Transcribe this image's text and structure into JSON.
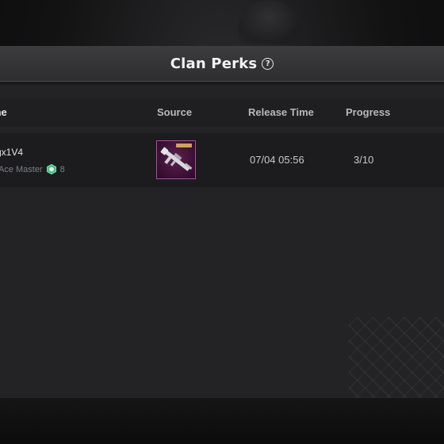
{
  "panel": {
    "title": "Clan Perks",
    "help_icon": "help-circle-icon"
  },
  "table": {
    "headers": {
      "name": "me",
      "source": "Source",
      "release_time": "Release Time",
      "progress": "Progress"
    },
    "rows": [
      {
        "player_name": "gx1V4",
        "rank_title": "Ace Master",
        "rank_icon": "rank-badge-icon",
        "rank_level": "8",
        "source_item": "rifle-skin-icon",
        "release_time": "07/04 05:56",
        "progress": "3/10"
      }
    ]
  },
  "colors": {
    "panel_bg": "#232325",
    "row_bg": "#1c1c1e",
    "source_border": "#b14a9a",
    "rank_badge": "#3fbf7f"
  }
}
